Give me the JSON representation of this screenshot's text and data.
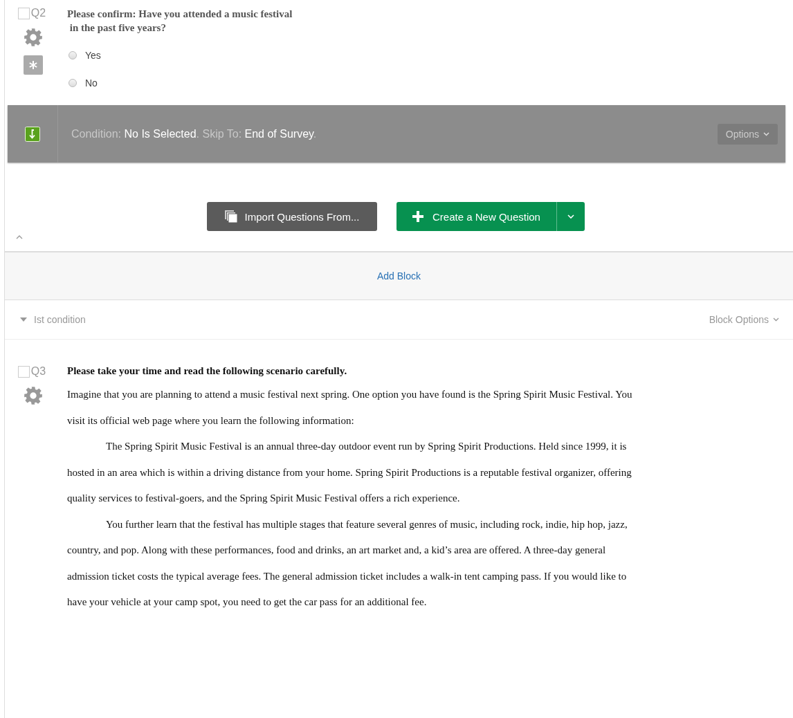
{
  "q2": {
    "number": "Q2",
    "checked": false,
    "question_lines": [
      "Please confirm: Have you attended a music festival",
      " in the past five years?"
    ],
    "options": [
      {
        "label": "Yes",
        "selected": false
      },
      {
        "label": "No",
        "selected": false
      }
    ]
  },
  "condition": {
    "segments": [
      {
        "kind": "label",
        "text": "Condition: "
      },
      {
        "kind": "value",
        "text": "No Is Selected"
      },
      {
        "kind": "label",
        "text": ". Skip To: "
      },
      {
        "kind": "value",
        "text": "End of Survey"
      },
      {
        "kind": "label",
        "text": "."
      }
    ],
    "options_button": "Options"
  },
  "actions": {
    "import_button": "Import Questions From...",
    "create_button": "Create a New Question"
  },
  "add_block": "Add Block",
  "block": {
    "title": "Ist condition",
    "expanded": true,
    "options": "Block Options"
  },
  "q3": {
    "number": "Q3",
    "checked": false,
    "paragraphs": [
      {
        "kind": "heading",
        "text": "Please take your time and read the following scenario carefully."
      },
      {
        "kind": "paragraph",
        "indented": false,
        "text": "Imagine that you are planning to attend a music festival next spring. One option you have found is the Spring Spirit Music Festival. You visit its official web page where you learn the following information:"
      },
      {
        "kind": "paragraph",
        "indented": true,
        "text": "The Spring Spirit Music Festival is an annual three-day outdoor event run by Spring Spirit Productions. Held since 1999, it is hosted in an area which is within a driving distance from your home. Spring Spirit Productions is a reputable festival organizer, offering quality services to festival-goers, and the Spring Spirit Music Festival offers a rich experience."
      },
      {
        "kind": "paragraph",
        "indented": true,
        "text": "You further learn that the festival has multiple stages that feature several genres of music, including rock, indie, hip hop, jazz, country, and pop. Along with these performances, food and drinks, an art market and, a kid’s area are offered. A three-day general admission ticket costs the typical average fees. The general admission ticket includes a walk-in tent camping pass. If you would like to have your vehicle at your camp spot, you need to get the car pass for an additional fee."
      }
    ]
  }
}
